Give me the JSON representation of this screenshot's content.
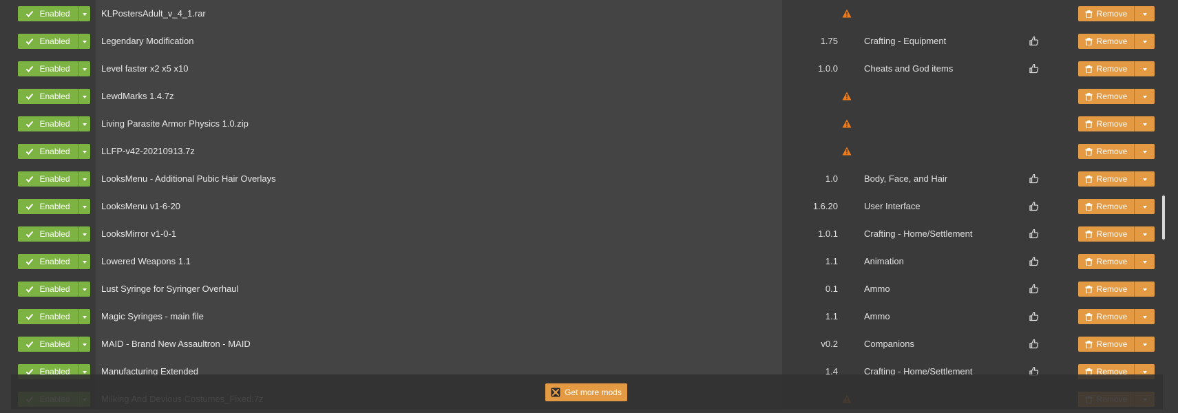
{
  "labels": {
    "enabled": "Enabled",
    "remove": "Remove",
    "get_more_mods": "Get more mods"
  },
  "icons": {
    "enabled": "check-icon",
    "dropdown": "chevron-down-icon",
    "warning": "warning-icon",
    "endorse": "thumbs-up-icon",
    "remove": "trash-icon",
    "get_more": "nexus-logo-icon"
  },
  "colors": {
    "enabled_green": "#7cb342",
    "accent_orange": "#e39a43",
    "warning_orange": "#f07d1a"
  },
  "mods": [
    {
      "name": "KLPostersAdult_v_4_1.rar",
      "version": "",
      "category": "",
      "warning": true,
      "endorse": false
    },
    {
      "name": "Legendary Modification",
      "version": "1.75",
      "category": "Crafting - Equipment",
      "warning": false,
      "endorse": true
    },
    {
      "name": "Level faster x2 x5 x10",
      "version": "1.0.0",
      "category": "Cheats and God items",
      "warning": false,
      "endorse": true
    },
    {
      "name": "LewdMarks 1.4.7z",
      "version": "",
      "category": "",
      "warning": true,
      "endorse": false
    },
    {
      "name": "Living Parasite Armor Physics 1.0.zip",
      "version": "",
      "category": "",
      "warning": true,
      "endorse": false
    },
    {
      "name": "LLFP-v42-20210913.7z",
      "version": "",
      "category": "",
      "warning": true,
      "endorse": false
    },
    {
      "name": "LooksMenu - Additional Pubic Hair Overlays",
      "version": "1.0",
      "category": "Body, Face, and Hair",
      "warning": false,
      "endorse": true
    },
    {
      "name": "LooksMenu v1-6-20",
      "version": "1.6.20",
      "category": "User Interface",
      "warning": false,
      "endorse": true
    },
    {
      "name": "LooksMirror v1-0-1",
      "version": "1.0.1",
      "category": "Crafting - Home/Settlement",
      "warning": false,
      "endorse": true
    },
    {
      "name": "Lowered Weapons 1.1",
      "version": "1.1",
      "category": "Animation",
      "warning": false,
      "endorse": true
    },
    {
      "name": "Lust Syringe for Syringer Overhaul",
      "version": "0.1",
      "category": "Ammo",
      "warning": false,
      "endorse": true
    },
    {
      "name": "Magic Syringes - main file",
      "version": "1.1",
      "category": "Ammo",
      "warning": false,
      "endorse": true
    },
    {
      "name": "MAID - Brand New Assaultron - MAID",
      "version": "v0.2",
      "category": "Companions",
      "warning": false,
      "endorse": true
    },
    {
      "name": "Manufacturing Extended",
      "version": "1.4",
      "category": "Crafting - Home/Settlement",
      "warning": false,
      "endorse": true
    },
    {
      "name": "Milking And Devious Costumes_Fixed.7z",
      "version": "",
      "category": "",
      "warning": true,
      "endorse": false
    }
  ]
}
